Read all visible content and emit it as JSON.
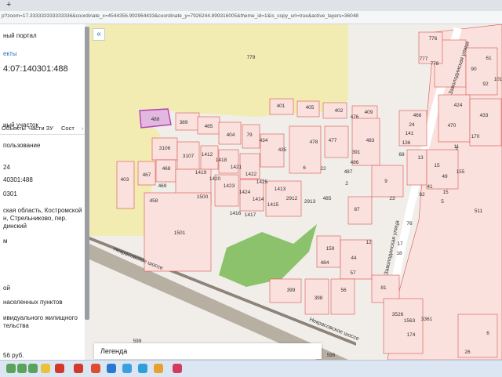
{
  "browser": {
    "new_tab": "+",
    "url": "p?zoom=17.333333333333336&coordinate_x=4544356.992964433&coordinate_y=7926244.899316005&theme_id=1&is_copy_url=true&active_layers=36048"
  },
  "left_panel": {
    "lines": [
      "ный портал",
      "екты",
      "4:07:140301:488",
      "ный участок",
      "пользование",
      "24",
      "40301:488",
      "0301",
      "ская область, Костромской",
      "н, Стрельниково, пер.",
      "динский",
      "м",
      "ой",
      "населенных пунктов",
      "ивидуального жилищного",
      "тельства",
      "56 руб."
    ],
    "tabs": [
      "Объекты",
      "Части ЗУ",
      "Сост",
      "›"
    ]
  },
  "map": {
    "collapse_label": "«",
    "legend_label": "Легенда",
    "colors": {
      "parcel_stroke": "#d9534f",
      "parcel_fill": "#fbe1dd",
      "selected_stroke": "#b33fb3",
      "selected_fill": "#e2b8e0",
      "park": "#8cc26b",
      "field": "#f2ecb2"
    },
    "street_labels": [
      "Заволодинская улица",
      "Заволодинская улица",
      "Некрасовское шоссе",
      "Некрасовское шоссе"
    ],
    "parcels": [
      "776",
      "777",
      "778",
      "779",
      "401",
      "405",
      "402",
      "409",
      "466",
      "476",
      "488",
      "389",
      "465",
      "404",
      "79",
      "434",
      "435",
      "478",
      "477",
      "483",
      "391",
      "486",
      "487",
      "3106",
      "3107",
      "1412",
      "1418",
      "1421",
      "1422",
      "1425",
      "1413",
      "467",
      "468",
      "1419",
      "1420",
      "1423",
      "1424",
      "1414",
      "1415",
      "2912",
      "2913",
      "485",
      "403",
      "469",
      "458",
      "1500",
      "1416",
      "1417",
      "1501",
      "87",
      "23",
      "9",
      "2",
      "6",
      "22",
      "68",
      "136",
      "141",
      "24",
      "13",
      "82",
      "1",
      "41",
      "155",
      "49",
      "15",
      "511",
      "76",
      "12",
      "17",
      "159",
      "44",
      "18",
      "484",
      "57",
      "56",
      "81",
      "398",
      "399",
      "596",
      "599",
      "3526",
      "1563",
      "3361",
      "170",
      "174",
      "26",
      "90",
      "92",
      "61",
      "101",
      "424",
      "433",
      "470",
      "15",
      "11",
      "5",
      "6"
    ]
  }
}
